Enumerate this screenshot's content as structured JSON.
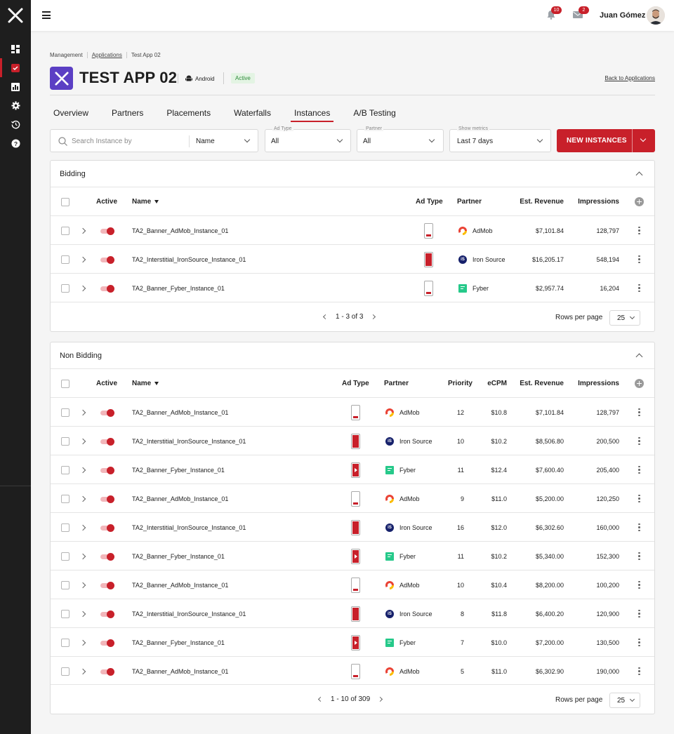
{
  "topbar": {
    "notifications_count": "10",
    "messages_count": "2",
    "user_name": "Juan Gómez"
  },
  "breadcrumb": [
    "Management",
    "Applications",
    "Test App 02"
  ],
  "app": {
    "title": "TEST APP 02",
    "platform": "Android",
    "status": "Active",
    "back_link": "Back to Applications"
  },
  "tabs": [
    "Overview",
    "Partners",
    "Placements",
    "Waterfalls",
    "Instances",
    "A/B Testing"
  ],
  "active_tab": "Instances",
  "filters": {
    "search_placeholder": "Search Instance by",
    "search_field": "Name",
    "ad_type_label": "Ad Type",
    "ad_type_value": "All",
    "partner_label": "Partner",
    "partner_value": "All",
    "metrics_label": "Show metrics",
    "metrics_value": "Last 7 days",
    "new_button": "NEW INSTANCES"
  },
  "colors": {
    "accent": "#c8202a",
    "sidebar": "#1e1e1e",
    "app_icon": "#5b3fc4",
    "active_badge_bg": "#e3f4e3",
    "active_badge_text": "#2e8b3a"
  },
  "bidding": {
    "title": "Bidding",
    "headers": {
      "active": "Active",
      "name": "Name",
      "ad_type": "Ad Type",
      "partner": "Partner",
      "revenue": "Est. Revenue",
      "impressions": "Impressions"
    },
    "rows": [
      {
        "name": "TA2_Banner_AdMob_Instance_01",
        "ad_type": "banner",
        "partner": "AdMob",
        "partner_icon": "admob",
        "revenue": "$7,101.84",
        "impressions": "128,797"
      },
      {
        "name": "TA2_Interstitial_IronSource_Instance_01",
        "ad_type": "interstitial",
        "partner": "Iron Source",
        "partner_icon": "ironsource",
        "revenue": "$16,205.17",
        "impressions": "548,194"
      },
      {
        "name": "TA2_Banner_Fyber_Instance_01",
        "ad_type": "banner",
        "partner": "Fyber",
        "partner_icon": "fyber",
        "revenue": "$2,957.74",
        "impressions": "16,204"
      }
    ],
    "pagination": {
      "range": "1 - ",
      "of": "3 of ",
      "total": "3"
    },
    "rows_per_page_label": "Rows per page",
    "rows_per_page": "25"
  },
  "non_bidding": {
    "title": "Non Bidding",
    "headers": {
      "active": "Active",
      "name": "Name",
      "ad_type": "Ad Type",
      "partner": "Partner",
      "priority": "Priority",
      "ecpm": "eCPM",
      "revenue": "Est. Revenue",
      "impressions": "Impressions"
    },
    "rows": [
      {
        "name": "TA2_Banner_AdMob_Instance_01",
        "ad_type": "banner",
        "partner": "AdMob",
        "partner_icon": "admob",
        "priority": "12",
        "ecpm": "$10.8",
        "revenue": "$7,101.84",
        "impressions": "128,797"
      },
      {
        "name": "TA2_Interstitial_IronSource_Instance_01",
        "ad_type": "interstitial",
        "partner": "Iron Source",
        "partner_icon": "ironsource",
        "priority": "10",
        "ecpm": "$10.2",
        "revenue": "$8,506.80",
        "impressions": "200,500"
      },
      {
        "name": "TA2_Banner_Fyber_Instance_01",
        "ad_type": "video",
        "partner": "Fyber",
        "partner_icon": "fyber",
        "priority": "11",
        "ecpm": "$12.4",
        "revenue": "$7,600.40",
        "impressions": "205,400"
      },
      {
        "name": "TA2_Banner_AdMob_Instance_01",
        "ad_type": "banner",
        "partner": "AdMob",
        "partner_icon": "admob",
        "priority": "9",
        "ecpm": "$11.0",
        "revenue": "$5,200.00",
        "impressions": "120,250"
      },
      {
        "name": "TA2_Interstitial_IronSource_Instance_01",
        "ad_type": "interstitial",
        "partner": "Iron Source",
        "partner_icon": "ironsource",
        "priority": "16",
        "ecpm": "$12.0",
        "revenue": "$6,302.60",
        "impressions": "160,000"
      },
      {
        "name": "TA2_Banner_Fyber_Instance_01",
        "ad_type": "video",
        "partner": "Fyber",
        "partner_icon": "fyber",
        "priority": "11",
        "ecpm": "$10.2",
        "revenue": "$5,340.00",
        "impressions": "152,300"
      },
      {
        "name": "TA2_Banner_AdMob_Instance_01",
        "ad_type": "banner",
        "partner": "AdMob",
        "partner_icon": "admob",
        "priority": "10",
        "ecpm": "$10.4",
        "revenue": "$8,200.00",
        "impressions": "100,200"
      },
      {
        "name": "TA2_Interstitial_IronSource_Instance_01",
        "ad_type": "interstitial",
        "partner": "Iron Source",
        "partner_icon": "ironsource",
        "priority": "8",
        "ecpm": "$11.8",
        "revenue": "$6,400.20",
        "impressions": "120,900"
      },
      {
        "name": "TA2_Banner_Fyber_Instance_01",
        "ad_type": "video",
        "partner": "Fyber",
        "partner_icon": "fyber",
        "priority": "7",
        "ecpm": "$10.0",
        "revenue": "$7,200.00",
        "impressions": "130,500"
      },
      {
        "name": "TA2_Banner_AdMob_Instance_01",
        "ad_type": "banner",
        "partner": "AdMob",
        "partner_icon": "admob",
        "priority": "5",
        "ecpm": "$11.0",
        "revenue": "$6,302.90",
        "impressions": "190,000"
      }
    ],
    "pagination": "1 - 10 of 309",
    "rows_per_page_label": "Rows per page",
    "rows_per_page": "25"
  },
  "icons": {
    "sidebar": [
      "dashboard-icon",
      "applications-icon",
      "reports-icon",
      "settings-icon",
      "history-icon",
      "help-icon"
    ],
    "topbar": [
      "menu-icon",
      "bell-icon",
      "mail-icon"
    ]
  }
}
